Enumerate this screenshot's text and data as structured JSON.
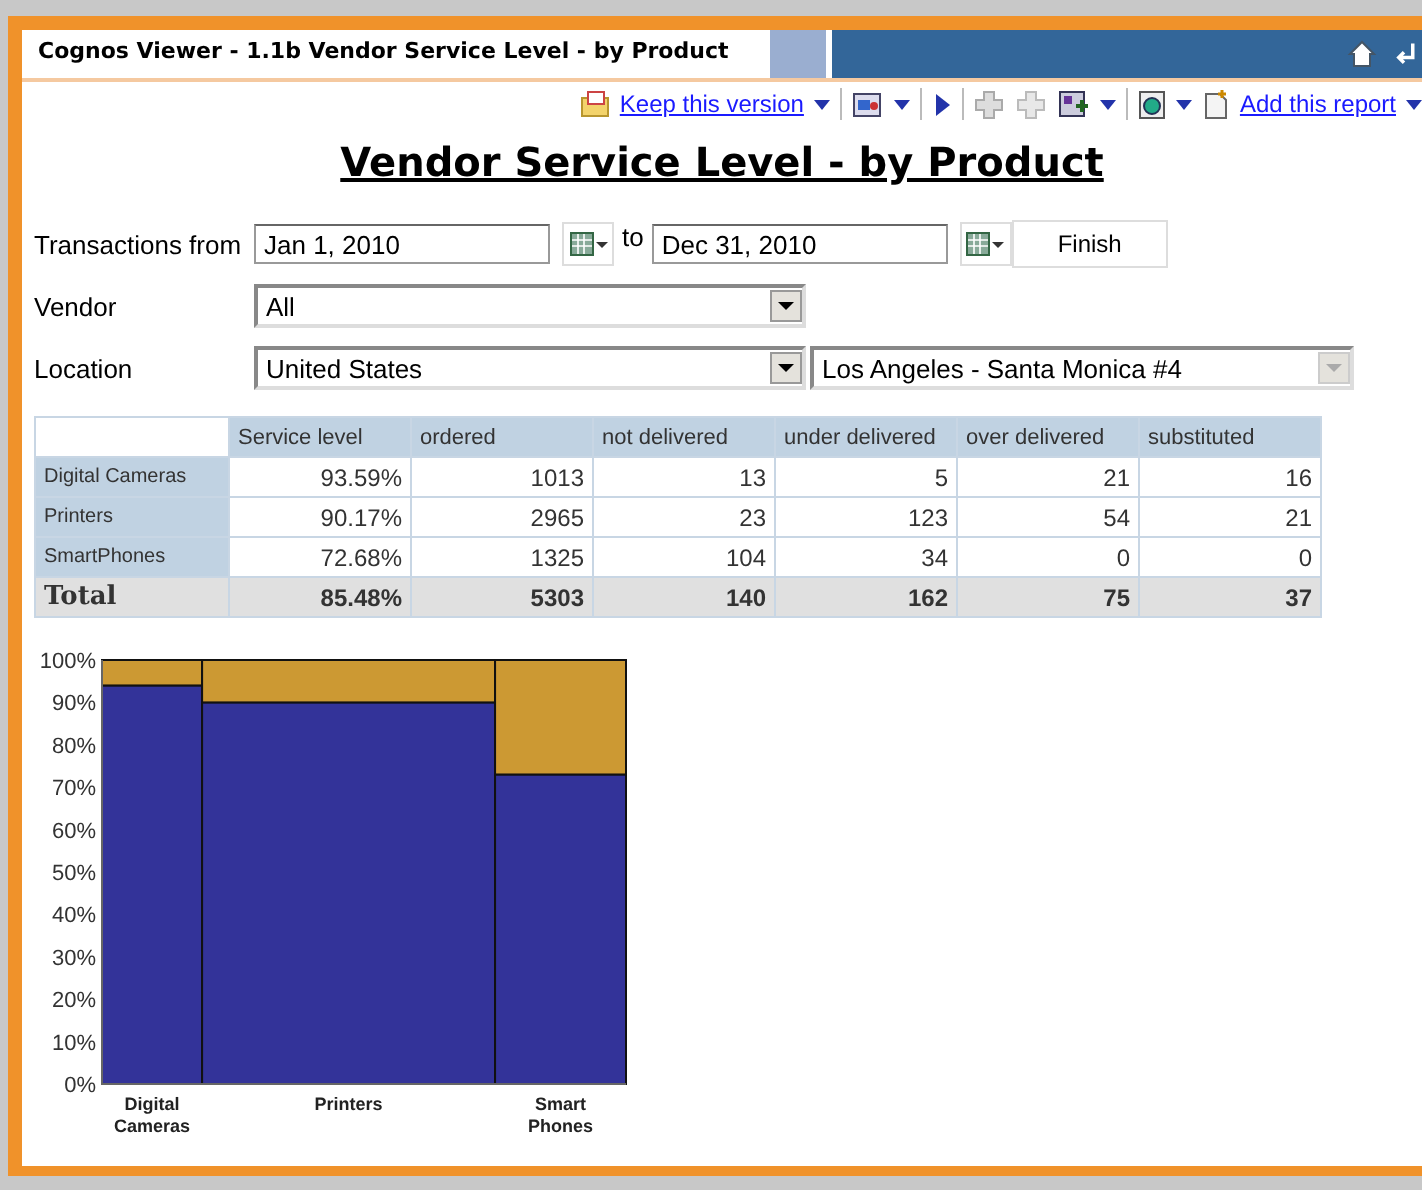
{
  "window": {
    "title": "Cognos Viewer - 1.1b Vendor Service Level - by Product"
  },
  "toolbar": {
    "keep_link": "Keep this version",
    "add_link": "Add this report"
  },
  "report_title": "Vendor Service Level - by Product",
  "filters": {
    "transactions_label": "Transactions from",
    "from_value": "Jan 1, 2010",
    "to_label": "to",
    "to_value": "Dec 31, 2010",
    "finish": "Finish",
    "vendor_label": "Vendor",
    "vendor_value": "All",
    "location_label": "Location",
    "location_value": "United States",
    "store_value": "Los Angeles - Santa Monica #4"
  },
  "table": {
    "columns": [
      "Service level",
      "ordered",
      "not delivered",
      "under delivered",
      "over delivered",
      "substituted"
    ],
    "rows": [
      {
        "label": "Digital Cameras",
        "cells": [
          "93.59%",
          "1013",
          "13",
          "5",
          "21",
          "16"
        ]
      },
      {
        "label": "Printers",
        "cells": [
          "90.17%",
          "2965",
          "23",
          "123",
          "54",
          "21"
        ]
      },
      {
        "label": "SmartPhones",
        "cells": [
          "72.68%",
          "1325",
          "104",
          "34",
          "0",
          "0"
        ]
      }
    ],
    "total": {
      "label": "Total",
      "cells": [
        "85.48%",
        "5303",
        "140",
        "162",
        "75",
        "37"
      ]
    }
  },
  "chart": {
    "chart_data": {
      "type": "bar",
      "stacked": true,
      "categories": [
        "Digital Cameras",
        "Printers",
        "Smart Phones"
      ],
      "series": [
        {
          "color": "#333399",
          "values": [
            94,
            90,
            73
          ]
        },
        {
          "color": "#cc9933",
          "values": [
            6,
            10,
            27
          ]
        }
      ],
      "ylim": [
        0,
        100
      ],
      "yticks": [
        {
          "value": 0,
          "label": "0%"
        },
        {
          "value": 10,
          "label": "10%"
        },
        {
          "value": 20,
          "label": "20%"
        },
        {
          "value": 30,
          "label": "30%"
        },
        {
          "value": 40,
          "label": "40%"
        },
        {
          "value": 50,
          "label": "50%"
        },
        {
          "value": 60,
          "label": "60%"
        },
        {
          "value": 70,
          "label": "70%"
        },
        {
          "value": 80,
          "label": "80%"
        },
        {
          "value": 90,
          "label": "90%"
        },
        {
          "value": 100,
          "label": "100%"
        }
      ]
    }
  }
}
